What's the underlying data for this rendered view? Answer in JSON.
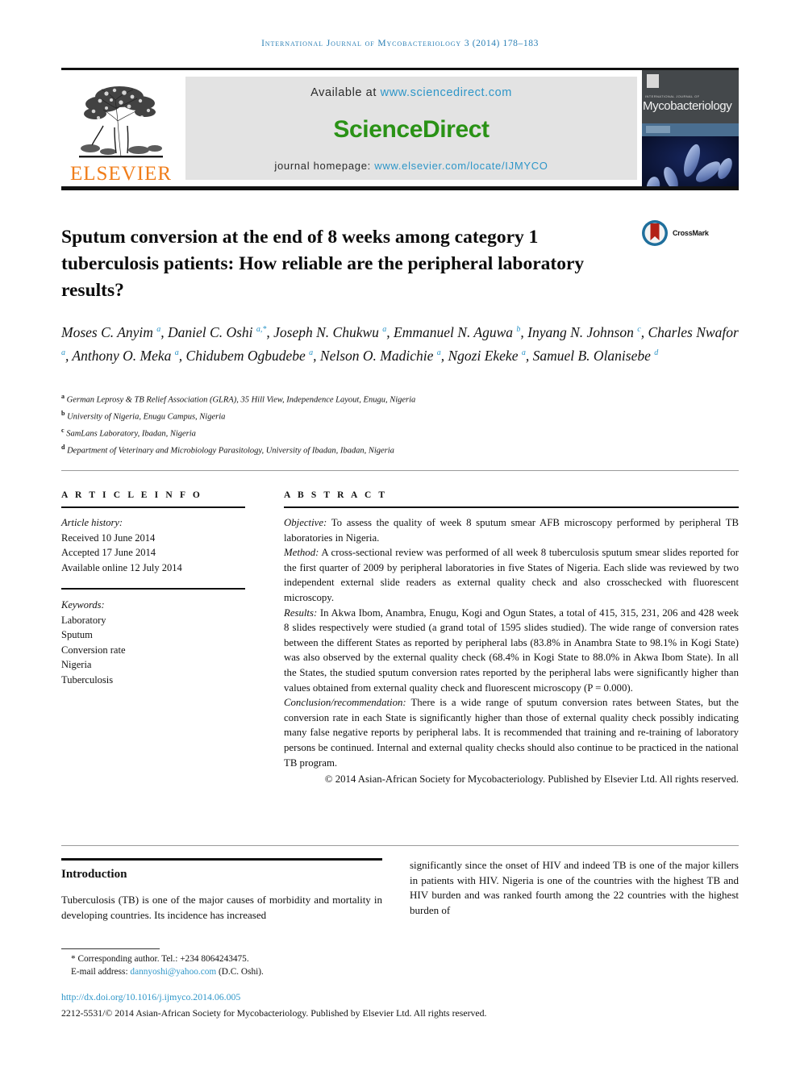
{
  "running_head": {
    "journal_name": "International Journal of Mycobacteriology",
    "volume_info": "3 (2014) 178–183"
  },
  "masthead": {
    "publisher_name": "ELSEVIER",
    "publisher_logo_icon": "elsevier-tree-icon",
    "available_prefix": "Available at",
    "available_url": "www.sciencedirect.com",
    "sciencedirect_logo": "ScienceDirect",
    "homepage_prefix": "journal homepage:",
    "homepage_url": "www.elsevier.com/locate/IJMYCO",
    "cover": {
      "publisher_mark": "ELSEVIER",
      "series_line": "INTERNATIONAL JOURNAL OF",
      "title": "Mycobacteriology",
      "image_icon": "bacteria-microscopy-image"
    },
    "colors": {
      "link_blue": "#2e96c8",
      "sciencedirect_green": "#2a9216",
      "elsevier_orange": "#f07d1a",
      "panel_grey": "#e3e3e3"
    }
  },
  "article": {
    "title": "Sputum conversion at the end of 8 weeks among category 1 tuberculosis patients: How reliable are the peripheral laboratory results?",
    "crossmark": {
      "label": "CrossMark",
      "icon": "crossmark-icon"
    },
    "authors_html": "Moses C. Anyim <sup>a</sup>, Daniel C. Oshi <sup>a,*</sup>, Joseph N. Chukwu <sup>a</sup>, Emmanuel N. Aguwa <sup>b</sup>, Inyang N. Johnson <sup>c</sup>, Charles Nwafor <sup>a</sup>, Anthony O. Meka <sup>a</sup>, Chidubem Ogbudebe <sup>a</sup>, Nelson O. Madichie <sup>a</sup>, Ngozi Ekeke <sup>a</sup>, Samuel B. Olanisebe <sup>d</sup>",
    "authors_plain": "Moses C. Anyim a, Daniel C. Oshi a,*, Joseph N. Chukwu a, Emmanuel N. Aguwa b, Inyang N. Johnson c, Charles Nwafor a, Anthony O. Meka a, Chidubem Ogbudebe a, Nelson O. Madichie a, Ngozi Ekeke a, Samuel B. Olanisebe d",
    "affiliations": [
      {
        "marker": "a",
        "text": "German Leprosy & TB Relief Association (GLRA), 35 Hill View, Independence Layout, Enugu, Nigeria"
      },
      {
        "marker": "b",
        "text": "University of Nigeria, Enugu Campus, Nigeria"
      },
      {
        "marker": "c",
        "text": "SamLans Laboratory, Ibadan, Nigeria"
      },
      {
        "marker": "d",
        "text": "Department of Veterinary and Microbiology Parasitology, University of Ibadan, Ibadan, Nigeria"
      }
    ]
  },
  "article_info": {
    "heading": "A R T I C L E   I N F O",
    "history_label": "Article history:",
    "history": [
      "Received 10 June 2014",
      "Accepted 17 June 2014",
      "Available online 12 July 2014"
    ],
    "keywords_label": "Keywords:",
    "keywords": [
      "Laboratory",
      "Sputum",
      "Conversion rate",
      "Nigeria",
      "Tuberculosis"
    ]
  },
  "abstract": {
    "heading": "A B S T R A C T",
    "sections": [
      {
        "label": "Objective:",
        "text": " To assess the quality of week 8 sputum smear AFB microscopy performed by peripheral TB laboratories in Nigeria."
      },
      {
        "label": "Method:",
        "text": " A cross-sectional review was performed of all week 8 tuberculosis sputum smear slides reported for the first quarter of 2009 by peripheral laboratories in five States of Nigeria. Each slide was reviewed by two independent external slide readers as external quality check and also crosschecked with fluorescent microscopy."
      },
      {
        "label": "Results:",
        "text": " In Akwa Ibom, Anambra, Enugu, Kogi and Ogun States, a total of 415, 315, 231, 206 and 428 week 8 slides respectively were studied (a grand total of 1595 slides studied). The wide range of conversion rates between the different States as reported by peripheral labs (83.8% in Anambra State to 98.1% in Kogi State) was also observed by the external quality check (68.4% in Kogi State to 88.0% in Akwa Ibom State). In all the States, the studied sputum conversion rates reported by the peripheral labs were significantly higher than values obtained from external quality check and fluorescent microscopy (P = 0.000)."
      },
      {
        "label": "Conclusion/recommendation:",
        "text": " There is a wide range of sputum conversion rates between States, but the conversion rate in each State is significantly higher than those of external quality check possibly indicating many false negative reports by peripheral labs. It is recommended that training and re-training of laboratory persons be continued. Internal and external quality checks should also continue to be practiced in the national TB program."
      }
    ],
    "copyright": "© 2014 Asian-African Society for Mycobacteriology. Published by Elsevier Ltd. All rights reserved."
  },
  "introduction": {
    "heading": "Introduction",
    "column_left": "Tuberculosis (TB) is one of the major causes of morbidity and mortality in developing countries. Its incidence has increased",
    "column_right": "significantly since the onset of HIV and indeed TB is one of the major killers in patients with HIV. Nigeria is one of the countries with the highest TB and HIV burden and was ranked fourth among the 22 countries with the highest burden of"
  },
  "footer": {
    "corresponding_marker": "*",
    "corresponding_author": "Corresponding author. Tel.: +234 8064243475.",
    "email_label": "E-mail address:",
    "email": "dannyoshi@yahoo.com",
    "email_owner": "(D.C. Oshi).",
    "doi_url": "http://dx.doi.org/10.1016/j.ijmyco.2014.06.005",
    "issn_line": "2212-5531/© 2014 Asian-African Society for Mycobacteriology. Published by Elsevier Ltd. All rights reserved."
  }
}
